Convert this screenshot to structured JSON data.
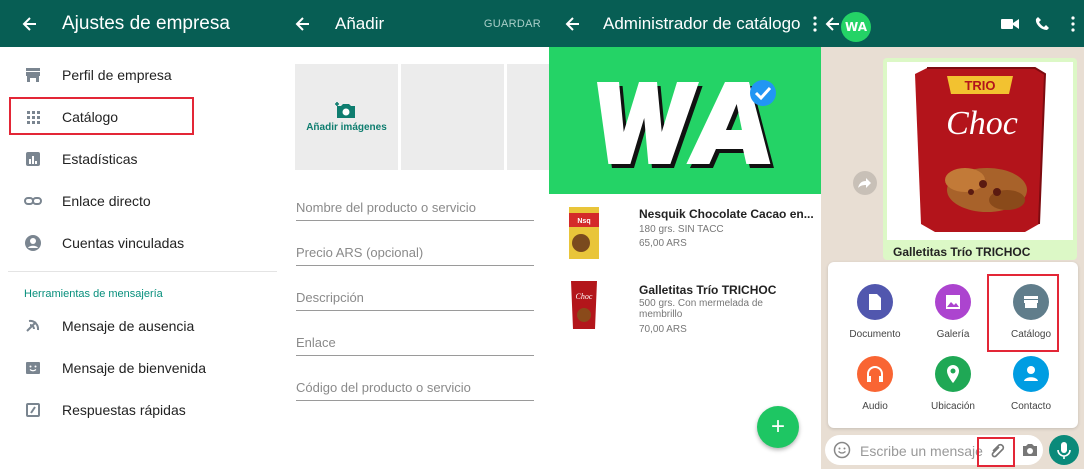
{
  "panel1": {
    "title": "Ajustes de empresa",
    "items": [
      {
        "label": "Perfil de empresa",
        "icon": "store-icon"
      },
      {
        "label": "Catálogo",
        "icon": "grid-icon"
      },
      {
        "label": "Estadísticas",
        "icon": "bar-chart-icon"
      },
      {
        "label": "Enlace directo",
        "icon": "link-icon"
      },
      {
        "label": "Cuentas vinculadas",
        "icon": "account-icon"
      }
    ],
    "section_title": "Herramientas de mensajería",
    "tools": [
      {
        "label": "Mensaje de ausencia",
        "icon": "away-icon"
      },
      {
        "label": "Mensaje de bienvenida",
        "icon": "welcome-icon"
      },
      {
        "label": "Respuestas rápidas",
        "icon": "quick-reply-icon"
      }
    ]
  },
  "panel2": {
    "title": "Añadir",
    "save_label": "GUARDAR",
    "add_images_label": "Añadir imágenes",
    "fields": [
      "Nombre del producto o servicio",
      "Precio ARS (opcional)",
      "Descripción",
      "Enlace",
      "Código del producto o servicio"
    ]
  },
  "panel3": {
    "title": "Administrador de catálogo",
    "banner_text": "WA",
    "products": [
      {
        "name": "Nesquik Chocolate Cacao en...",
        "desc": "180 grs. SIN TACC",
        "price": "65,00 ARS"
      },
      {
        "name": "Galletitas Trío TRICHOC",
        "desc": "500 grs. Con mermelada de membrillo",
        "price": "70,00 ARS"
      }
    ],
    "fab_label": "+"
  },
  "panel4": {
    "avatar_text": "WA",
    "message_caption": "Galletitas Trío TRICHOC",
    "product_brand": "TRIO",
    "product_name": "Choc",
    "attach": [
      {
        "label": "Documento",
        "color": "#5157ae",
        "icon": "document-icon"
      },
      {
        "label": "Galería",
        "color": "#ac44cf",
        "icon": "gallery-icon"
      },
      {
        "label": "Catálogo",
        "color": "#607d8b",
        "icon": "catalog-icon"
      },
      {
        "label": "Audio",
        "color": "#f96533",
        "icon": "headphones-icon"
      },
      {
        "label": "Ubicación",
        "color": "#1fa855",
        "icon": "location-icon"
      },
      {
        "label": "Contacto",
        "color": "#009de2",
        "icon": "contact-icon"
      }
    ],
    "input_placeholder": "Escribe un mensaje"
  },
  "colors": {
    "header": "#075e54",
    "accent": "#24d366",
    "highlight": "#e32636"
  }
}
